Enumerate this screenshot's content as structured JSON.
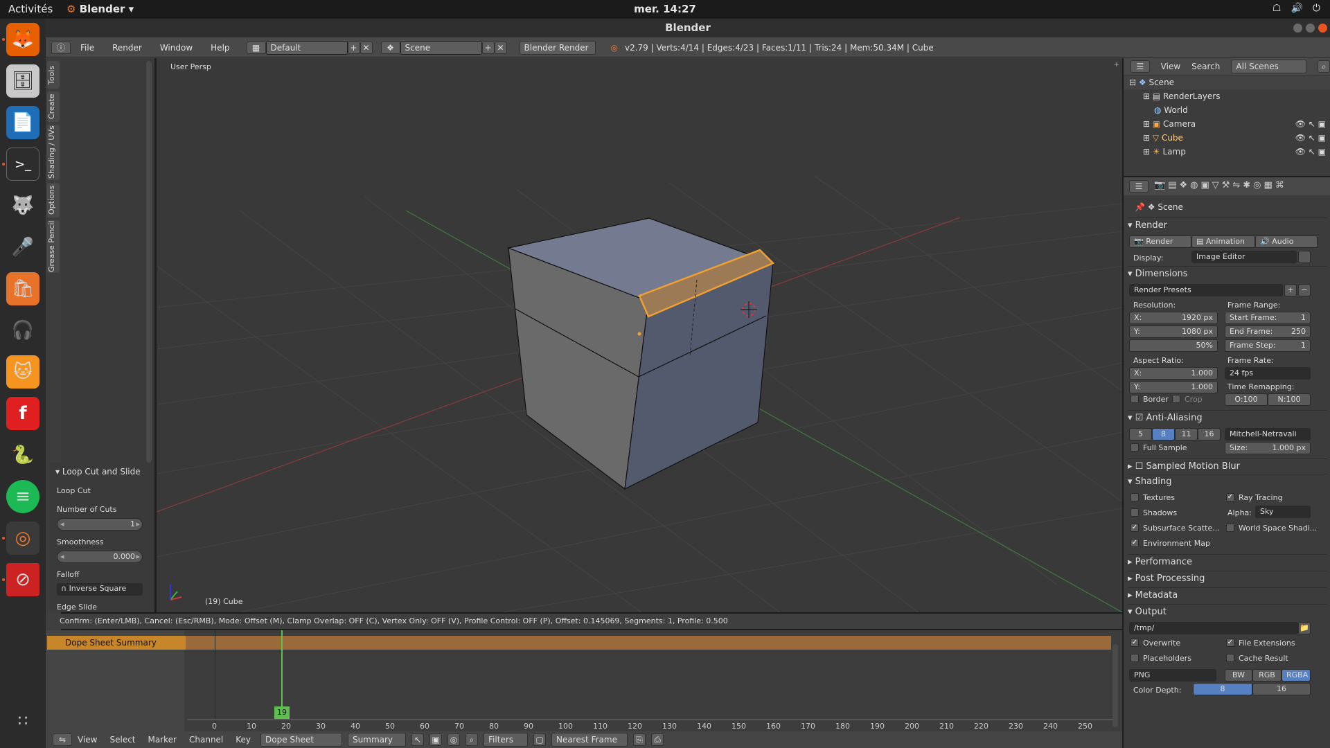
{
  "system": {
    "activities": "Activités",
    "app_name": "Blender",
    "clock": "mer. 14:27",
    "tray_icons": [
      "network-icon",
      "volume-icon",
      "power-icon"
    ]
  },
  "window": {
    "title": "Blender"
  },
  "infobar": {
    "menus": [
      "File",
      "Render",
      "Window",
      "Help"
    ],
    "layout": "Default",
    "scene": "Scene",
    "engine": "Blender Render",
    "stats": "v2.79 | Verts:4/14 | Edges:4/23 | Faces:1/11 | Tris:24 | Mem:50.34M | Cube"
  },
  "tool_tabs": [
    "Tools",
    "Create",
    "Shading / UVs",
    "Options",
    "Grease Pencil"
  ],
  "last_operator": {
    "title": "Loop Cut and Slide",
    "section": "Loop Cut",
    "cuts_label": "Number of Cuts",
    "cuts_value": "1",
    "smooth_label": "Smoothness",
    "smooth_value": "0.000",
    "falloff_label": "Falloff",
    "falloff_value": "Inverse Square",
    "edge_slide": "Edge Slide"
  },
  "viewport": {
    "label": "User Persp",
    "object_info": "(19) Cube"
  },
  "status": "Confirm: (Enter/LMB), Cancel: (Esc/RMB), Mode: Offset (M), Clamp Overlap: OFF (C), Vertex Only: OFF (V), Profile Control: OFF (P), Offset: 0.145069, Segments: 1, Profile: 0.500",
  "dopesheet": {
    "summary": "Dope Sheet Summary",
    "current_frame": "19",
    "ticks": [
      "0",
      "10",
      "20",
      "30",
      "40",
      "50",
      "60",
      "70",
      "80",
      "90",
      "100",
      "110",
      "120",
      "130",
      "140",
      "150",
      "160",
      "170",
      "180",
      "190",
      "200",
      "210",
      "220",
      "230",
      "240",
      "250"
    ],
    "menus": [
      "View",
      "Select",
      "Marker",
      "Channel",
      "Key"
    ],
    "mode": "Dope Sheet",
    "summary_btn": "Summary",
    "filters": "Filters",
    "snap": "Nearest Frame"
  },
  "outliner": {
    "menus": [
      "View",
      "Search"
    ],
    "filter": "All Scenes",
    "items": [
      "Scene",
      "RenderLayers",
      "World",
      "Camera",
      "Cube",
      "Lamp"
    ]
  },
  "properties": {
    "scene": "Scene",
    "render": {
      "title": "Render",
      "buttons": [
        "Render",
        "Animation",
        "Audio"
      ],
      "display_label": "Display:",
      "display_value": "Image Editor"
    },
    "dimensions": {
      "title": "Dimensions",
      "presets": "Render Presets",
      "resolution": "Resolution:",
      "res_x": "1920 px",
      "res_y": "1080 px",
      "percent": "50%",
      "frame_range": "Frame Range:",
      "start": "1",
      "end": "250",
      "step": "1",
      "aspect": "Aspect Ratio:",
      "aspect_x": "1.000",
      "aspect_y": "1.000",
      "frame_rate": "Frame Rate:",
      "fps": "24 fps",
      "border": "Border",
      "crop": "Crop",
      "time_remap": "Time Remapping:",
      "old": "O:100",
      "new": "N:100"
    },
    "aa": {
      "title": "Anti-Aliasing",
      "samples": [
        "5",
        "8",
        "11",
        "16"
      ],
      "filter": "Mitchell-Netravali",
      "full_sample": "Full Sample",
      "size": "1.000 px"
    },
    "motion_blur": "Sampled Motion Blur",
    "shading": {
      "title": "Shading",
      "textures": "Textures",
      "ray_tracing": "Ray Tracing",
      "shadows": "Shadows",
      "alpha": "Alpha:",
      "alpha_value": "Sky",
      "sss": "Subsurface Scatte...",
      "world_space": "World Space Shadi...",
      "env_map": "Environment Map"
    },
    "performance": "Performance",
    "post_processing": "Post Processing",
    "metadata": "Metadata",
    "output": {
      "title": "Output",
      "path": "/tmp/",
      "overwrite": "Overwrite",
      "file_ext": "File Extensions",
      "placeholders": "Placeholders",
      "cache": "Cache Result",
      "format": "PNG",
      "modes": [
        "BW",
        "RGB",
        "RGBA"
      ],
      "depth_label": "Color Depth:",
      "depths": [
        "8",
        "16"
      ]
    }
  }
}
